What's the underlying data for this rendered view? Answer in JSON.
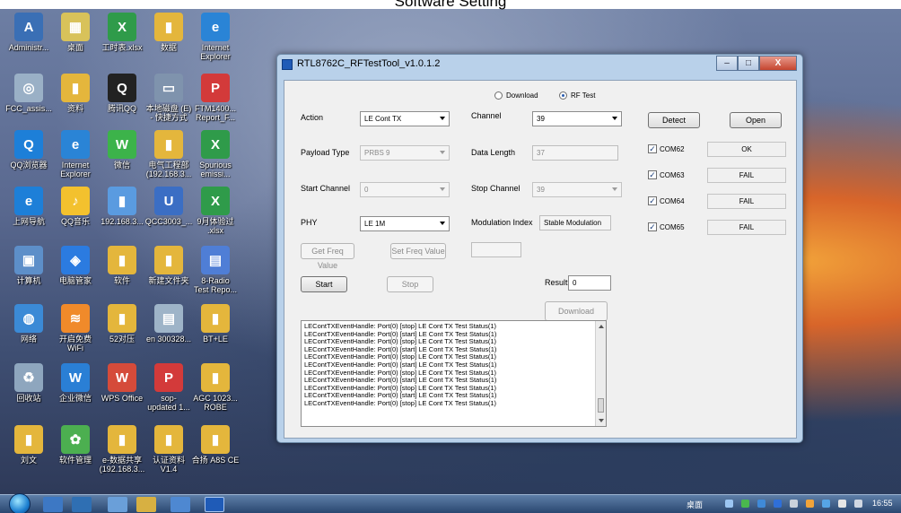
{
  "page_title": "Software Setting",
  "desktop_icons": [
    {
      "label": "Administr...",
      "icon": "admin-user-icon",
      "color": "#3a6fb5",
      "glyph": "A"
    },
    {
      "label": "桌面",
      "icon": "desktop-grid-icon",
      "color": "#d8c25a",
      "glyph": "▦"
    },
    {
      "label": "工时表.xlsx",
      "icon": "excel-icon",
      "color": "#2f9b4a",
      "glyph": "X"
    },
    {
      "label": "数据",
      "icon": "folder-icon",
      "color": "#e4b63c",
      "glyph": "▮"
    },
    {
      "label": "Internet\nExplorer",
      "icon": "ie-icon",
      "color": "#2a84d6",
      "glyph": "e"
    },
    {
      "label": "FCC_assis...",
      "icon": "tool-icon",
      "color": "#9ab0c6",
      "glyph": "◎"
    },
    {
      "label": "资料",
      "icon": "folder-icon",
      "color": "#e4b63c",
      "glyph": "▮"
    },
    {
      "label": "腾讯QQ",
      "icon": "qq-icon",
      "color": "#222222",
      "glyph": "Q"
    },
    {
      "label": "本地磁盘 (E)\n- 快捷方式",
      "icon": "drive-shortcut-icon",
      "color": "#7f93ad",
      "glyph": "▭"
    },
    {
      "label": "FTM1400...\nReport_F...",
      "icon": "pdf-icon",
      "color": "#d33a3a",
      "glyph": "P"
    },
    {
      "label": "QQ浏览器",
      "icon": "qq-browser-icon",
      "color": "#1d7fd8",
      "glyph": "Q"
    },
    {
      "label": "Internet\nExplorer",
      "icon": "ie-icon",
      "color": "#2a84d6",
      "glyph": "e"
    },
    {
      "label": "微信",
      "icon": "wechat-icon",
      "color": "#3cb34a",
      "glyph": "W"
    },
    {
      "label": "电气工程部\n(192.168.3...",
      "icon": "network-folder-icon",
      "color": "#e4b63c",
      "glyph": "▮"
    },
    {
      "label": "Spurious\nemissi...",
      "icon": "excel-icon",
      "color": "#2f9b4a",
      "glyph": "X"
    },
    {
      "label": "上网导航",
      "icon": "navigation-icon",
      "color": "#1d7fd8",
      "glyph": "e"
    },
    {
      "label": "QQ音乐",
      "icon": "qq-music-icon",
      "color": "#f3c12e",
      "glyph": "♪"
    },
    {
      "label": "192.168.3...",
      "icon": "network-share-icon",
      "color": "#5a9be0",
      "glyph": "▮"
    },
    {
      "label": "QCC3003_...",
      "icon": "project-icon",
      "color": "#3b6ec4",
      "glyph": "U"
    },
    {
      "label": "9月体验过\n.xlsx",
      "icon": "excel-icon",
      "color": "#2f9b4a",
      "glyph": "X"
    },
    {
      "label": "计算机",
      "icon": "computer-icon",
      "color": "#5d8fc9",
      "glyph": "▣"
    },
    {
      "label": "电脑管家",
      "icon": "pc-manager-icon",
      "color": "#2b7be0",
      "glyph": "◈"
    },
    {
      "label": "软件",
      "icon": "folder-icon",
      "color": "#e4b63c",
      "glyph": "▮"
    },
    {
      "label": "新建文件夹",
      "icon": "folder-icon",
      "color": "#e4b63c",
      "glyph": "▮"
    },
    {
      "label": "8-Radio\nTest Repo...",
      "icon": "image-icon",
      "color": "#4f7ed6",
      "glyph": "▤"
    },
    {
      "label": "网络",
      "icon": "network-icon",
      "color": "#3b8ad6",
      "glyph": "◍"
    },
    {
      "label": "开启免费\nWiFi",
      "icon": "wifi-icon",
      "color": "#f08a2a",
      "glyph": "≋"
    },
    {
      "label": "52对压",
      "icon": "folder-icon",
      "color": "#e4b63c",
      "glyph": "▮"
    },
    {
      "label": "en 300328...",
      "icon": "document-icon",
      "color": "#9eb4c8",
      "glyph": "▤"
    },
    {
      "label": "BT+LE",
      "icon": "folder-icon",
      "color": "#e4b63c",
      "glyph": "▮"
    },
    {
      "label": "回收站",
      "icon": "recycle-bin-icon",
      "color": "#8ea6be",
      "glyph": "♻"
    },
    {
      "label": "企业微信",
      "icon": "work-wechat-icon",
      "color": "#2a7fd5",
      "glyph": "W"
    },
    {
      "label": "WPS Office",
      "icon": "wps-icon",
      "color": "#d54b3a",
      "glyph": "W"
    },
    {
      "label": "sop-\nupdated 1...",
      "icon": "pdf-icon",
      "color": "#d33a3a",
      "glyph": "P"
    },
    {
      "label": "AGC 1023...\nROBE",
      "icon": "folder-icon",
      "color": "#e4b63c",
      "glyph": "▮"
    },
    {
      "label": "刘文",
      "icon": "folder-icon",
      "color": "#e4b63c",
      "glyph": "▮"
    },
    {
      "label": "软件管理",
      "icon": "software-manager-icon",
      "color": "#4caf50",
      "glyph": "✿"
    },
    {
      "label": "e-数据共享\n(192.168.3...",
      "icon": "network-folder-icon",
      "color": "#e4b63c",
      "glyph": "▮"
    },
    {
      "label": "认证资料\nV1.4",
      "icon": "folder-icon",
      "color": "#e4b63c",
      "glyph": "▮"
    },
    {
      "label": "合扬 A8S CE",
      "icon": "folder-icon",
      "color": "#e4b63c",
      "glyph": "▮"
    }
  ],
  "window": {
    "title": "RTL8762C_RFTestTool_v1.0.1.2",
    "minimize": "–",
    "maximize": "□",
    "close": "X",
    "mode_download": "Download",
    "mode_rftest": "RF Test",
    "action_label": "Action",
    "action_value": "LE Cont TX",
    "channel_label": "Channel",
    "channel_value": "39",
    "payload_label": "Payload Type",
    "payload_value": "PRBS 9",
    "data_length_label": "Data Length",
    "data_length_value": "37",
    "start_channel_label": "Start Channel",
    "start_channel_value": "0",
    "stop_channel_label": "Stop Channel",
    "stop_channel_value": "39",
    "phy_label": "PHY",
    "phy_value": "LE 1M",
    "modulation_label": "Modulation Index",
    "modulation_value": "Stable Modulation",
    "get_freq_label": "Get Freq Value",
    "set_freq_label": "Set Freq Value",
    "start_label": "Start",
    "stop_label": "Stop",
    "result_label": "Result",
    "result_value": "0",
    "download_label": "Download",
    "detect_label": "Detect",
    "open_label": "Open",
    "com_ports": [
      {
        "name": "COM62",
        "status": "OK"
      },
      {
        "name": "COM63",
        "status": "FAIL"
      },
      {
        "name": "COM64",
        "status": "FAIL"
      },
      {
        "name": "COM65",
        "status": "FAIL"
      }
    ],
    "log_lines": [
      "LEContTXEventHandle: Port(0) [stop] LE Cont TX Test Status(1)",
      "LEContTXEventHandle: Port(0) [start] LE Cont TX Test Status(1)",
      "LEContTXEventHandle: Port(0) [stop] LE Cont TX Test Status(1)",
      "LEContTXEventHandle: Port(0) [start] LE Cont TX Test Status(1)",
      "LEContTXEventHandle: Port(0) [stop] LE Cont TX Test Status(1)",
      "LEContTXEventHandle: Port(0) [start] LE Cont TX Test Status(1)",
      "LEContTXEventHandle: Port(0) [stop] LE Cont TX Test Status(1)",
      "LEContTXEventHandle: Port(0) [start] LE Cont TX Test Status(1)",
      "LEContTXEventHandle: Port(0) [stop] LE Cont TX Test Status(1)",
      "LEContTXEventHandle: Port(0) [start] LE Cont TX Test Status(1)",
      "LEContTXEventHandle: Port(0) [stop] LE Cont TX Test Status(1)"
    ]
  },
  "taskbar": {
    "tray_label": "桌面",
    "clock": "16:55"
  }
}
